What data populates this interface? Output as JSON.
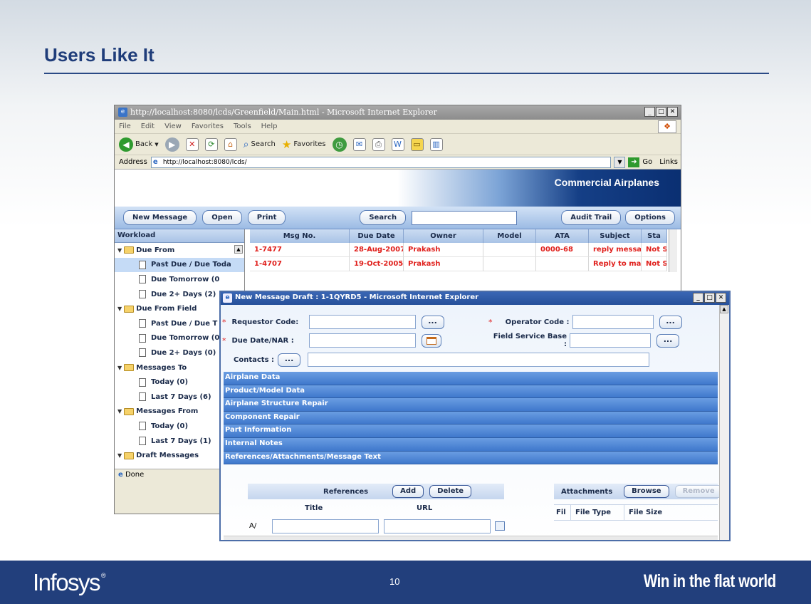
{
  "slide": {
    "title": "Users Like It",
    "page_number": "10",
    "brand": "Infosys",
    "brand_mark": "®",
    "tagline": "Win in the flat world"
  },
  "browser": {
    "title": "http://localhost:8080/lcds/Greenfield/Main.html - Microsoft Internet Explorer",
    "menus": [
      "File",
      "Edit",
      "View",
      "Favorites",
      "Tools",
      "Help"
    ],
    "toolbar": {
      "back": "Back",
      "search": "Search",
      "favorites": "Favorites"
    },
    "address_label": "Address",
    "address_value": "http://localhost:8080/lcds/",
    "go": "Go",
    "links": "Links",
    "status": "Done"
  },
  "app": {
    "banner": "Commercial Airplanes",
    "buttons": {
      "new_message": "New Message",
      "open": "Open",
      "print": "Print",
      "search": "Search",
      "audit_trail": "Audit Trail",
      "options": "Options"
    },
    "workload_title": "Workload",
    "tree": [
      {
        "label": "Due From",
        "level": 0,
        "kind": "folder"
      },
      {
        "label": "Past Due / Due Toda",
        "level": 1,
        "kind": "doc",
        "selected": true
      },
      {
        "label": "Due Tomorrow (0",
        "level": 1,
        "kind": "doc"
      },
      {
        "label": "Due 2+ Days (2)",
        "level": 1,
        "kind": "doc"
      },
      {
        "label": "Due From Field",
        "level": 0,
        "kind": "folder"
      },
      {
        "label": "Past Due / Due T",
        "level": 1,
        "kind": "doc"
      },
      {
        "label": "Due Tomorrow (0",
        "level": 1,
        "kind": "doc"
      },
      {
        "label": "Due 2+ Days (0)",
        "level": 1,
        "kind": "doc"
      },
      {
        "label": "Messages To",
        "level": 0,
        "kind": "folder"
      },
      {
        "label": "Today (0)",
        "level": 1,
        "kind": "doc"
      },
      {
        "label": "Last 7 Days (6)",
        "level": 1,
        "kind": "doc"
      },
      {
        "label": "Messages From",
        "level": 0,
        "kind": "folder"
      },
      {
        "label": "Today (0)",
        "level": 1,
        "kind": "doc"
      },
      {
        "label": "Last 7 Days (1)",
        "level": 1,
        "kind": "doc"
      },
      {
        "label": "Draft Messages",
        "level": 0,
        "kind": "folder"
      }
    ],
    "grid_columns": [
      "Msg No.",
      "Due Date",
      "Owner",
      "Model",
      "ATA",
      "Subject",
      "Sta"
    ],
    "grid_rows": [
      [
        "1-7477",
        "28-Aug-2007",
        "Prakash",
        "",
        "0000-68",
        "reply message",
        "Not S"
      ],
      [
        "1-4707",
        "19-Oct-2005",
        "Prakash",
        "",
        "",
        "Reply to mar",
        "Not S"
      ]
    ]
  },
  "popup": {
    "title": "New Message Draft : 1-1QYRD5 - Microsoft Internet Explorer",
    "labels": {
      "requestor_code": "Requestor Code:",
      "operator_code": "Operator Code :",
      "due_date": "Due Date/NAR :",
      "field_service_base": "Field Service Base :",
      "contacts": "Contacts :",
      "dots": "..."
    },
    "sections": [
      "Airplane Data",
      "Product/Model Data",
      "Airplane Structure Repair",
      "Component Repair",
      "Part Information",
      "Internal Notes",
      "References/Attachments/Message Text"
    ],
    "references": {
      "title": "References",
      "add": "Add",
      "delete": "Delete",
      "col_title": "Title",
      "col_url": "URL",
      "row_prefix": "A/"
    },
    "attachments": {
      "title": "Attachments",
      "browse": "Browse",
      "remove": "Remove",
      "col_file": "Fil",
      "col_type": "File Type",
      "col_size": "File Size"
    }
  }
}
